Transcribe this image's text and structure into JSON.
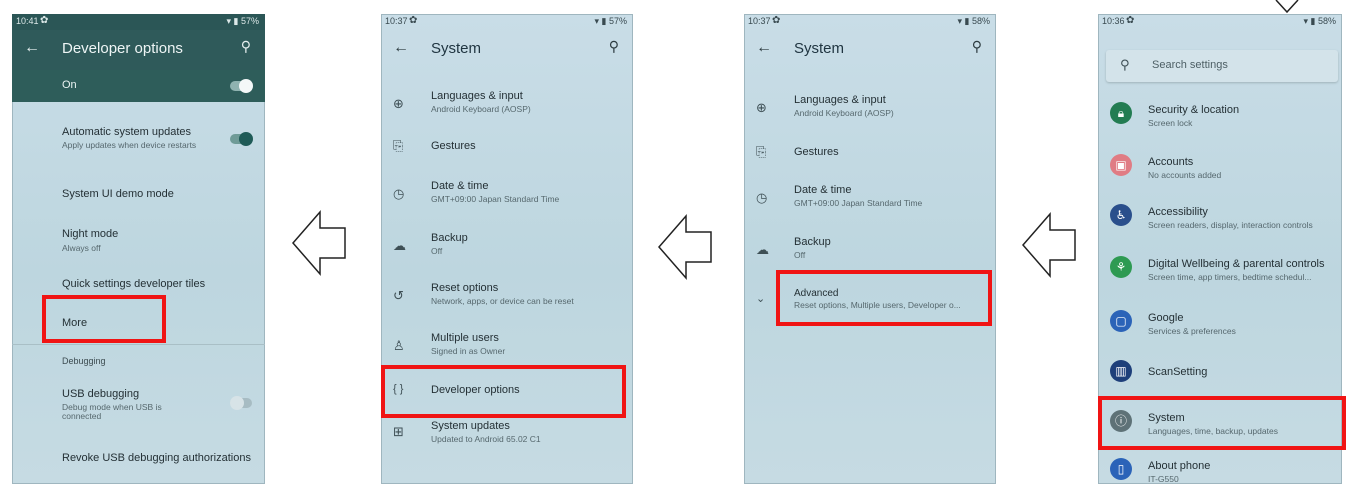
{
  "colors": {
    "highlight": "#f01414",
    "teal_bar": "#2f5a5a",
    "accent_toggle": "#2f6b69"
  },
  "screens": {
    "dev": {
      "status": {
        "time": "10:41",
        "battery": "57%"
      },
      "title": "Developer options",
      "on_label": "On",
      "items": [
        {
          "title": "Automatic system updates",
          "sub": "Apply updates when device restarts"
        },
        {
          "title": "System UI demo mode"
        },
        {
          "title": "Night mode",
          "sub": "Always off"
        },
        {
          "title": "Quick settings developer tiles"
        },
        {
          "title": "More"
        },
        {
          "title": "Debugging"
        },
        {
          "title": "USB debugging",
          "sub": "Debug mode when USB is connected"
        },
        {
          "title": "Revoke USB debugging authorizations"
        }
      ]
    },
    "sys2": {
      "status": {
        "time": "10:37",
        "battery": "57%"
      },
      "title": "System",
      "items": [
        {
          "title": "Languages & input",
          "sub": "Android Keyboard (AOSP)"
        },
        {
          "title": "Gestures"
        },
        {
          "title": "Date & time",
          "sub": "GMT+09:00 Japan Standard Time"
        },
        {
          "title": "Backup",
          "sub": "Off"
        },
        {
          "title": "Reset options",
          "sub": "Network, apps, or device can be reset"
        },
        {
          "title": "Multiple users",
          "sub": "Signed in as Owner"
        },
        {
          "title": "Developer options"
        },
        {
          "title": "System updates",
          "sub": "Updated to Android 65.02 C1"
        }
      ]
    },
    "sys1": {
      "status": {
        "time": "10:37",
        "battery": "58%"
      },
      "title": "System",
      "items": [
        {
          "title": "Languages & input",
          "sub": "Android Keyboard (AOSP)"
        },
        {
          "title": "Gestures"
        },
        {
          "title": "Date & time",
          "sub": "GMT+09:00 Japan Standard Time"
        },
        {
          "title": "Backup",
          "sub": "Off"
        },
        {
          "title": "Advanced",
          "sub": "Reset options, Multiple users, Developer o..."
        }
      ]
    },
    "settings": {
      "status": {
        "time": "10:36",
        "battery": "58%"
      },
      "search_placeholder": "Search settings",
      "items": [
        {
          "title": "Security & location",
          "sub": "Screen lock"
        },
        {
          "title": "Accounts",
          "sub": "No accounts added"
        },
        {
          "title": "Accessibility",
          "sub": "Screen readers, display, interaction controls"
        },
        {
          "title": "Digital Wellbeing & parental controls",
          "sub": "Screen time, app timers, bedtime schedul..."
        },
        {
          "title": "Google",
          "sub": "Services & preferences"
        },
        {
          "title": "ScanSetting"
        },
        {
          "title": "System",
          "sub": "Languages, time, backup, updates"
        },
        {
          "title": "About phone",
          "sub": "IT-G550"
        }
      ]
    }
  }
}
